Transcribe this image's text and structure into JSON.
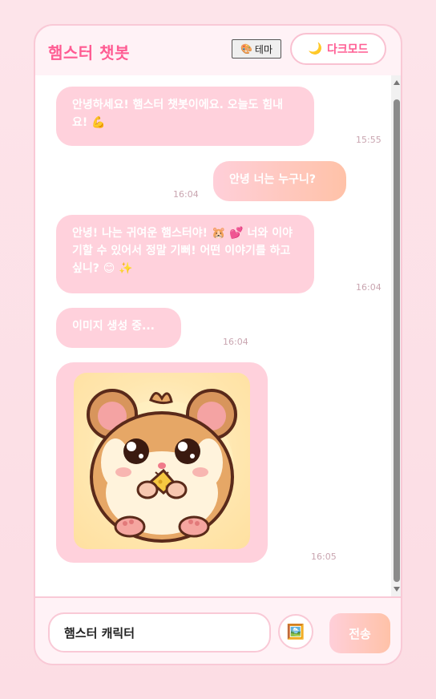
{
  "header": {
    "title": "햄스터 챗봇",
    "theme_label": "테마",
    "theme_icon": "🎨",
    "dark_mode_label": "다크모드",
    "dark_mode_icon": "🌙"
  },
  "messages": [
    {
      "sender": "bot",
      "text": "안녕하세요! 햄스터 챗봇이에요. 오늘도 힘내요! 💪",
      "time": "15:55"
    },
    {
      "sender": "user",
      "text": "안녕 너는 누구니?",
      "time": "16:04"
    },
    {
      "sender": "bot",
      "text": "안녕! 나는 귀여운 햄스터야! 🐹 💕 너와 이야기할 수 있어서 정말 기뻐! 어떤 이야기를 하고 싶니? 😊 ✨",
      "time": "16:04"
    },
    {
      "sender": "bot",
      "text": "이미지 생성 중...",
      "time": "16:04"
    },
    {
      "sender": "bot",
      "type": "image",
      "image": "hamster-character-illustration",
      "time": "16:05"
    }
  ],
  "composer": {
    "input_value": "햄스터 캐릭터",
    "image_button_icon": "🖼️",
    "send_label": "전송"
  }
}
